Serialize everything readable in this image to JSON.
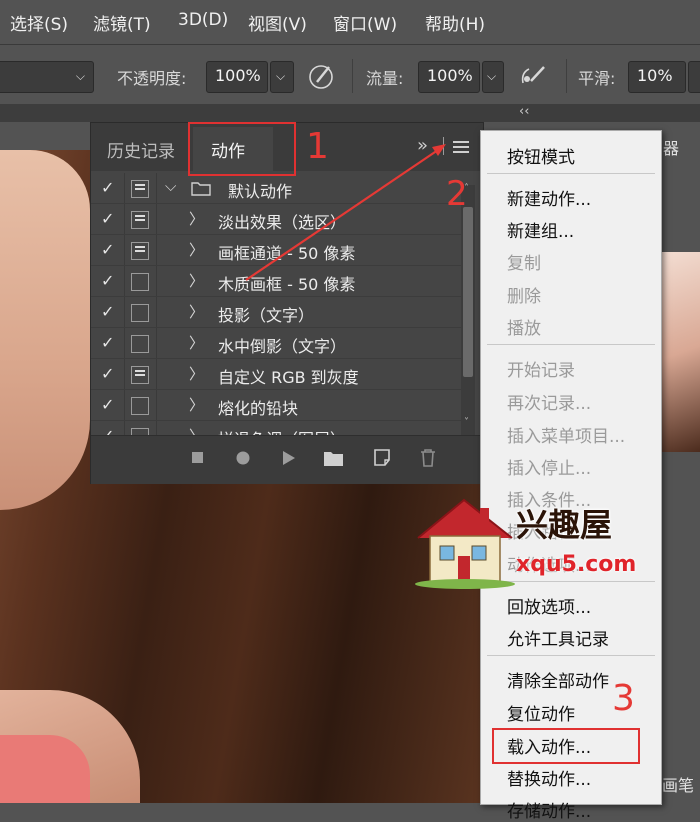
{
  "menubar": {
    "items": [
      "选择(S)",
      "滤镜(T)",
      "3D(D)",
      "视图(V)",
      "窗口(W)",
      "帮助(H)"
    ]
  },
  "options": {
    "opacity_label": "不透明度:",
    "opacity_value": "100%",
    "flow_label": "流量:",
    "flow_value": "100%",
    "smooth_label": "平滑:",
    "smooth_value": "10%"
  },
  "panel": {
    "tab_history": "历史记录",
    "tab_actions": "动作",
    "expand_glyph": "»",
    "rows": [
      {
        "label": "默认动作",
        "checked": true,
        "dialog": true
      },
      {
        "label": "淡出效果（选区）",
        "checked": true,
        "dialog": true
      },
      {
        "label": "画框通道 - 50 像素",
        "checked": true,
        "dialog": true
      },
      {
        "label": "木质画框 - 50 像素",
        "checked": true,
        "dialog": false
      },
      {
        "label": "投影（文字）",
        "checked": true,
        "dialog": false
      },
      {
        "label": "水中倒影（文字）",
        "checked": true,
        "dialog": false
      },
      {
        "label": "自定义 RGB 到灰度",
        "checked": true,
        "dialog": true
      },
      {
        "label": "熔化的铅块",
        "checked": true,
        "dialog": false
      },
      {
        "label": "拼退色调（图层）",
        "checked": true,
        "dialog": false
      }
    ]
  },
  "menu": {
    "items": [
      {
        "label": "按钮模式",
        "disabled": false
      },
      {
        "label": "新建动作...",
        "disabled": false
      },
      {
        "label": "新建组...",
        "disabled": false
      },
      {
        "label": "复制",
        "disabled": true
      },
      {
        "label": "删除",
        "disabled": true
      },
      {
        "label": "播放",
        "disabled": true
      },
      {
        "label": "开始记录",
        "disabled": true
      },
      {
        "label": "再次记录...",
        "disabled": true
      },
      {
        "label": "插入菜单项目...",
        "disabled": true
      },
      {
        "label": "插入停止...",
        "disabled": true
      },
      {
        "label": "插入条件...",
        "disabled": true
      },
      {
        "label": "插入路径",
        "disabled": true
      },
      {
        "label": "动作选项...",
        "disabled": true
      },
      {
        "label": "回放选项...",
        "disabled": false
      },
      {
        "label": "允许工具记录",
        "disabled": false
      },
      {
        "label": "清除全部动作",
        "disabled": false
      },
      {
        "label": "复位动作",
        "disabled": false
      },
      {
        "label": "载入动作...",
        "disabled": false
      },
      {
        "label": "替换动作...",
        "disabled": false
      },
      {
        "label": "存储动作...",
        "disabled": false
      }
    ]
  },
  "annotations": {
    "step1": "1",
    "step2": "2",
    "step3": "3"
  },
  "right_panel": {
    "collapse_glyph": "‹‹",
    "top_label": "器",
    "bottom_label": "画笔"
  },
  "watermark": {
    "title": "兴趣屋",
    "url": "xqu5.com"
  },
  "colors": {
    "annotation_red": "#e53935",
    "menu_bg": "#f0f0f0",
    "panel_bg": "#454545"
  }
}
